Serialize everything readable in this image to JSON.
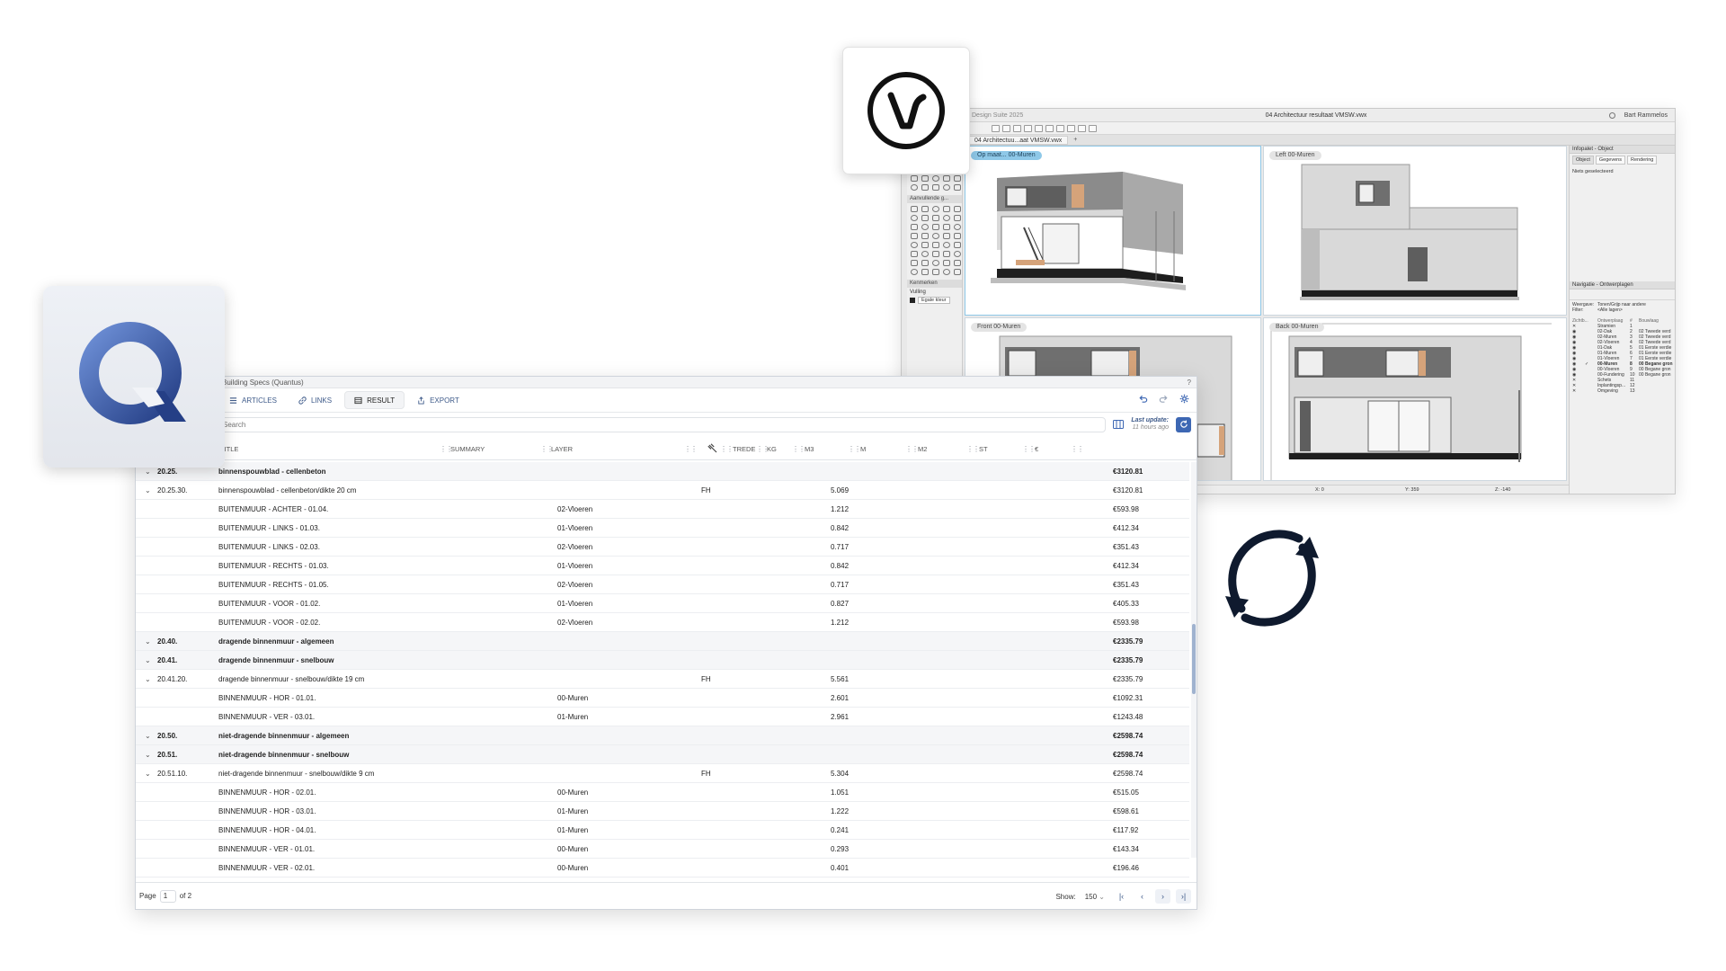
{
  "vectorworks": {
    "app_title": "Design Suite 2025",
    "doc_title": "04 Architectuur resultaat VMSW.vwx",
    "user": "Bart Rammelos",
    "doc_tab": "04 Architectuu...aat VMSW.vwx",
    "plus": "+",
    "tool_headers": [
      "Aanvullende g...",
      "Kenmerken"
    ],
    "vulling_label": "Vulling",
    "vulling_value": "Egale kleur",
    "viewports": [
      {
        "label": "Op maat... 00-Muren",
        "active": true
      },
      {
        "label": "Left  00-Muren",
        "active": false
      },
      {
        "label": "Front  00-Muren",
        "active": false
      },
      {
        "label": "Back  00-Muren",
        "active": false
      }
    ],
    "info_palette": {
      "title": "Infopalet - Object",
      "tabs": [
        "Object",
        "Gegevens",
        "Rendering"
      ],
      "empty_text": "Niets geselecteerd"
    },
    "navigation": {
      "title": "Navigatie - Ontwerplagen",
      "weergave_label": "Weergave:",
      "weergave_value": "Tonen/Grijp naar andere",
      "filter_label": "Filter:",
      "filter_value": "<Alle lagen>",
      "headers": [
        "Zichtb...",
        "Ontwerplaag",
        "#",
        "Bouwlaag"
      ],
      "layers": [
        {
          "name": "Stramien",
          "num": "1",
          "story": ""
        },
        {
          "name": "02-Dak",
          "num": "2",
          "story": "02 Tweede verd"
        },
        {
          "name": "02-Muren",
          "num": "3",
          "story": "02 Tweede verd"
        },
        {
          "name": "02-Vloeren",
          "num": "4",
          "story": "02 Tweede verd"
        },
        {
          "name": "01-Dak",
          "num": "5",
          "story": "01 Eerste verdie"
        },
        {
          "name": "01-Muren",
          "num": "6",
          "story": "01 Eerste verdie"
        },
        {
          "name": "01-Vloeren",
          "num": "7",
          "story": "01 Eerste verdie"
        },
        {
          "name": "00-Muren",
          "num": "8",
          "story": "00 Begane gron"
        },
        {
          "name": "00-Vloeren",
          "num": "9",
          "story": "00 Begane gron"
        },
        {
          "name": "00-Fundering",
          "num": "10",
          "story": "00 Begane gron"
        },
        {
          "name": "Schets",
          "num": "11",
          "story": ""
        },
        {
          "name": "Inplantingsp...",
          "num": "12",
          "story": ""
        },
        {
          "name": "Omgeving",
          "num": "13",
          "story": ""
        }
      ]
    },
    "status": {
      "x": "X: 0",
      "y": "Y: 359",
      "z": "Z: -140"
    }
  },
  "quantus": {
    "window_title": "Building Specs (Quantus)",
    "help": "?",
    "tabs": [
      {
        "label": "ARTICLES",
        "icon": "list-icon",
        "active": false
      },
      {
        "label": "LINKS",
        "icon": "link-icon",
        "active": false
      },
      {
        "label": "RESULT",
        "icon": "table-icon",
        "active": true
      },
      {
        "label": "EXPORT",
        "icon": "export-icon",
        "active": false
      }
    ],
    "search_placeholder": "Search",
    "last_update_label": "Last update:",
    "last_update_value": "11 hours ago",
    "columns": {
      "title": "TITLE",
      "summary": "SUMMARY",
      "layer": "LAYER",
      "trede": "TREDE",
      "kg": "KG",
      "m3": "M3",
      "m": "M",
      "m2": "M2",
      "st": "ST",
      "eur": "€"
    },
    "rows": [
      {
        "group": true,
        "chev": "⌄",
        "code": "20.25.",
        "title": "binnenspouwblad - cellenbeton",
        "layer": "",
        "trede": "",
        "m3": "",
        "eur": "€3120.81"
      },
      {
        "group": false,
        "chev": "⌄",
        "code": "20.25.30.",
        "title": "binnenspouwblad - cellenbeton/dikte 20 cm",
        "layer": "",
        "trede": "FH",
        "m3": "5.069",
        "eur": "€3120.81"
      },
      {
        "group": false,
        "chev": "",
        "code": "",
        "title": "BUITENMUUR - ACHTER - 01.04.",
        "layer": "02-Vloeren",
        "trede": "",
        "m3": "1.212",
        "eur": "€593.98"
      },
      {
        "group": false,
        "chev": "",
        "code": "",
        "title": "BUITENMUUR - LINKS - 01.03.",
        "layer": "01-Vloeren",
        "trede": "",
        "m3": "0.842",
        "eur": "€412.34"
      },
      {
        "group": false,
        "chev": "",
        "code": "",
        "title": "BUITENMUUR - LINKS - 02.03.",
        "layer": "02-Vloeren",
        "trede": "",
        "m3": "0.717",
        "eur": "€351.43"
      },
      {
        "group": false,
        "chev": "",
        "code": "",
        "title": "BUITENMUUR - RECHTS - 01.03.",
        "layer": "01-Vloeren",
        "trede": "",
        "m3": "0.842",
        "eur": "€412.34"
      },
      {
        "group": false,
        "chev": "",
        "code": "",
        "title": "BUITENMUUR - RECHTS - 01.05.",
        "layer": "02-Vloeren",
        "trede": "",
        "m3": "0.717",
        "eur": "€351.43"
      },
      {
        "group": false,
        "chev": "",
        "code": "",
        "title": "BUITENMUUR - VOOR - 01.02.",
        "layer": "01-Vloeren",
        "trede": "",
        "m3": "0.827",
        "eur": "€405.33"
      },
      {
        "group": false,
        "chev": "",
        "code": "",
        "title": "BUITENMUUR - VOOR - 02.02.",
        "layer": "02-Vloeren",
        "trede": "",
        "m3": "1.212",
        "eur": "€593.98"
      },
      {
        "group": true,
        "chev": "⌄",
        "code": "20.40.",
        "title": "dragende binnenmuur - algemeen",
        "layer": "",
        "trede": "",
        "m3": "",
        "eur": "€2335.79"
      },
      {
        "group": true,
        "chev": "⌄",
        "code": "20.41.",
        "title": "dragende binnenmuur - snelbouw",
        "layer": "",
        "trede": "",
        "m3": "",
        "eur": "€2335.79"
      },
      {
        "group": false,
        "chev": "⌄",
        "code": "20.41.20.",
        "title": "dragende binnenmuur - snelbouw/dikte 19 cm",
        "layer": "",
        "trede": "FH",
        "m3": "5.561",
        "eur": "€2335.79"
      },
      {
        "group": false,
        "chev": "",
        "code": "",
        "title": "BINNENMUUR - HOR - 01.01.",
        "layer": "00-Muren",
        "trede": "",
        "m3": "2.601",
        "eur": "€1092.31"
      },
      {
        "group": false,
        "chev": "",
        "code": "",
        "title": "BINNENMUUR - VER - 03.01.",
        "layer": "01-Muren",
        "trede": "",
        "m3": "2.961",
        "eur": "€1243.48"
      },
      {
        "group": true,
        "chev": "⌄",
        "code": "20.50.",
        "title": "niet-dragende binnenmuur - algemeen",
        "layer": "",
        "trede": "",
        "m3": "",
        "eur": "€2598.74"
      },
      {
        "group": true,
        "chev": "⌄",
        "code": "20.51.",
        "title": "niet-dragende binnenmuur - snelbouw",
        "layer": "",
        "trede": "",
        "m3": "",
        "eur": "€2598.74"
      },
      {
        "group": false,
        "chev": "⌄",
        "code": "20.51.10.",
        "title": "niet-dragende binnenmuur - snelbouw/dikte 9 cm",
        "layer": "",
        "trede": "FH",
        "m3": "5.304",
        "eur": "€2598.74"
      },
      {
        "group": false,
        "chev": "",
        "code": "",
        "title": "BINNENMUUR - HOR - 02.01.",
        "layer": "00-Muren",
        "trede": "",
        "m3": "1.051",
        "eur": "€515.05"
      },
      {
        "group": false,
        "chev": "",
        "code": "",
        "title": "BINNENMUUR - HOR - 03.01.",
        "layer": "01-Muren",
        "trede": "",
        "m3": "1.222",
        "eur": "€598.61"
      },
      {
        "group": false,
        "chev": "",
        "code": "",
        "title": "BINNENMUUR - HOR - 04.01.",
        "layer": "01-Muren",
        "trede": "",
        "m3": "0.241",
        "eur": "€117.92"
      },
      {
        "group": false,
        "chev": "",
        "code": "",
        "title": "BINNENMUUR - VER - 01.01.",
        "layer": "00-Muren",
        "trede": "",
        "m3": "0.293",
        "eur": "€143.34"
      },
      {
        "group": false,
        "chev": "",
        "code": "",
        "title": "BINNENMUUR - VER - 02.01.",
        "layer": "00-Muren",
        "trede": "",
        "m3": "0.401",
        "eur": "€196.46"
      }
    ],
    "footer": {
      "page_label": "Page",
      "page_value": "1",
      "of_label": "of 2",
      "show_label": "Show:",
      "show_value": "150"
    }
  },
  "colors": {
    "accent": "#3d67b3",
    "accent_text": "#3f5b8a",
    "sync_icon": "#0f1a2e",
    "quantus_logo_dark": "#253f86",
    "quantus_logo_light": "#6d8fd6"
  }
}
